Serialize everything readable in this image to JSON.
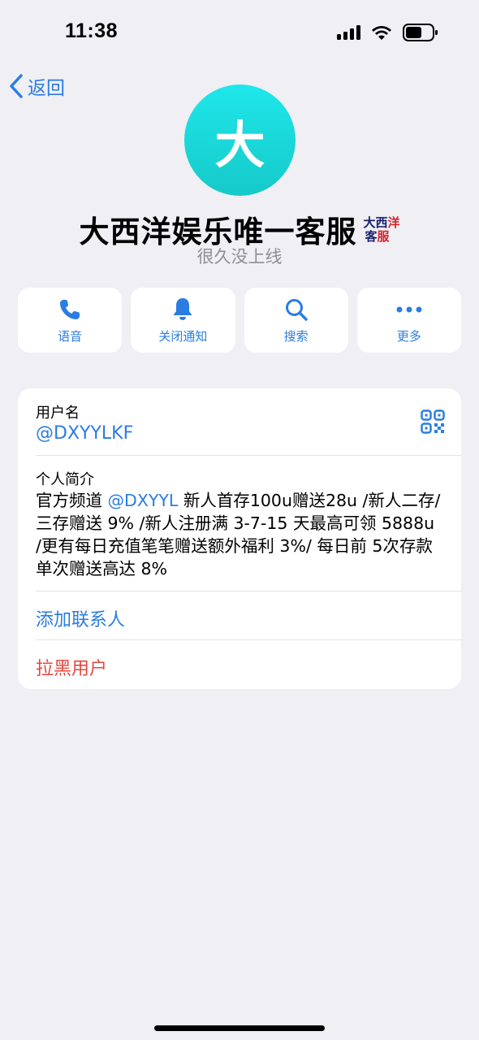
{
  "status_bar": {
    "time": "11:38"
  },
  "nav": {
    "back_label": "返回"
  },
  "profile": {
    "avatar_letter": "大",
    "avatar_color": "#1fe7ea",
    "name": "大西洋娱乐唯一客服",
    "badge_line1_a": "大西",
    "badge_line1_b": "洋",
    "badge_line2_a": "客",
    "badge_line2_b": "服",
    "last_seen": "很久没上线"
  },
  "actions": [
    {
      "label": "语音",
      "icon": "phone-icon"
    },
    {
      "label": "关闭通知",
      "icon": "bell-icon"
    },
    {
      "label": "搜索",
      "icon": "search-icon"
    },
    {
      "label": "更多",
      "icon": "more-icon"
    }
  ],
  "info": {
    "username_label": "用户名",
    "username": "@DXYYLKF",
    "bio_label": "个人简介",
    "bio_prefix": "官方频道 ",
    "bio_link": "@DXYYL",
    "bio_rest": " 新人首存100u赠送28u /新人二存/三存赠送 9% /新人注册满 3-7-15 天最高可领 5888u /更有每日充值笔笔赠送额外福利 3%/ 每日前 5次存款单次赠送高达 8%",
    "add_contact": "添加联系人",
    "block_user": "拉黑用户"
  },
  "colors": {
    "accent": "#2a7de1",
    "danger": "#e5473f",
    "background": "#efeff4"
  }
}
